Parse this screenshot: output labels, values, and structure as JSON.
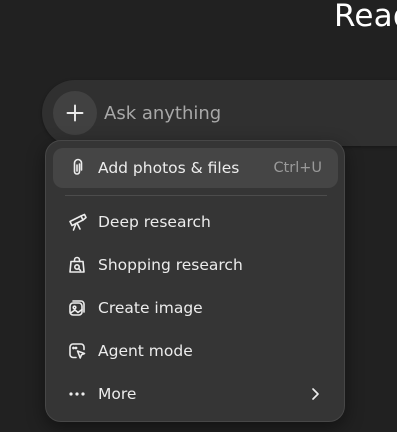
{
  "page": {
    "heading": "Ready when you are."
  },
  "composer": {
    "placeholder": "Ask anything"
  },
  "menu": {
    "add_files": {
      "label": "Add photos & files",
      "shortcut": "Ctrl+U",
      "icon": "paperclip-icon"
    },
    "items": [
      {
        "label": "Deep research",
        "icon": "telescope-icon"
      },
      {
        "label": "Shopping research",
        "icon": "shopping-bag-icon"
      },
      {
        "label": "Create image",
        "icon": "image-icon"
      },
      {
        "label": "Agent mode",
        "icon": "cursor-icon"
      },
      {
        "label": "More",
        "icon": "more-dots-icon",
        "has_submenu": true
      }
    ]
  },
  "colors": {
    "page_bg": "#212121",
    "composer_bg": "#303030",
    "menu_bg": "#353535",
    "highlight_bg": "#454545",
    "text": "#ececec",
    "muted_text": "#9a9a9a"
  }
}
